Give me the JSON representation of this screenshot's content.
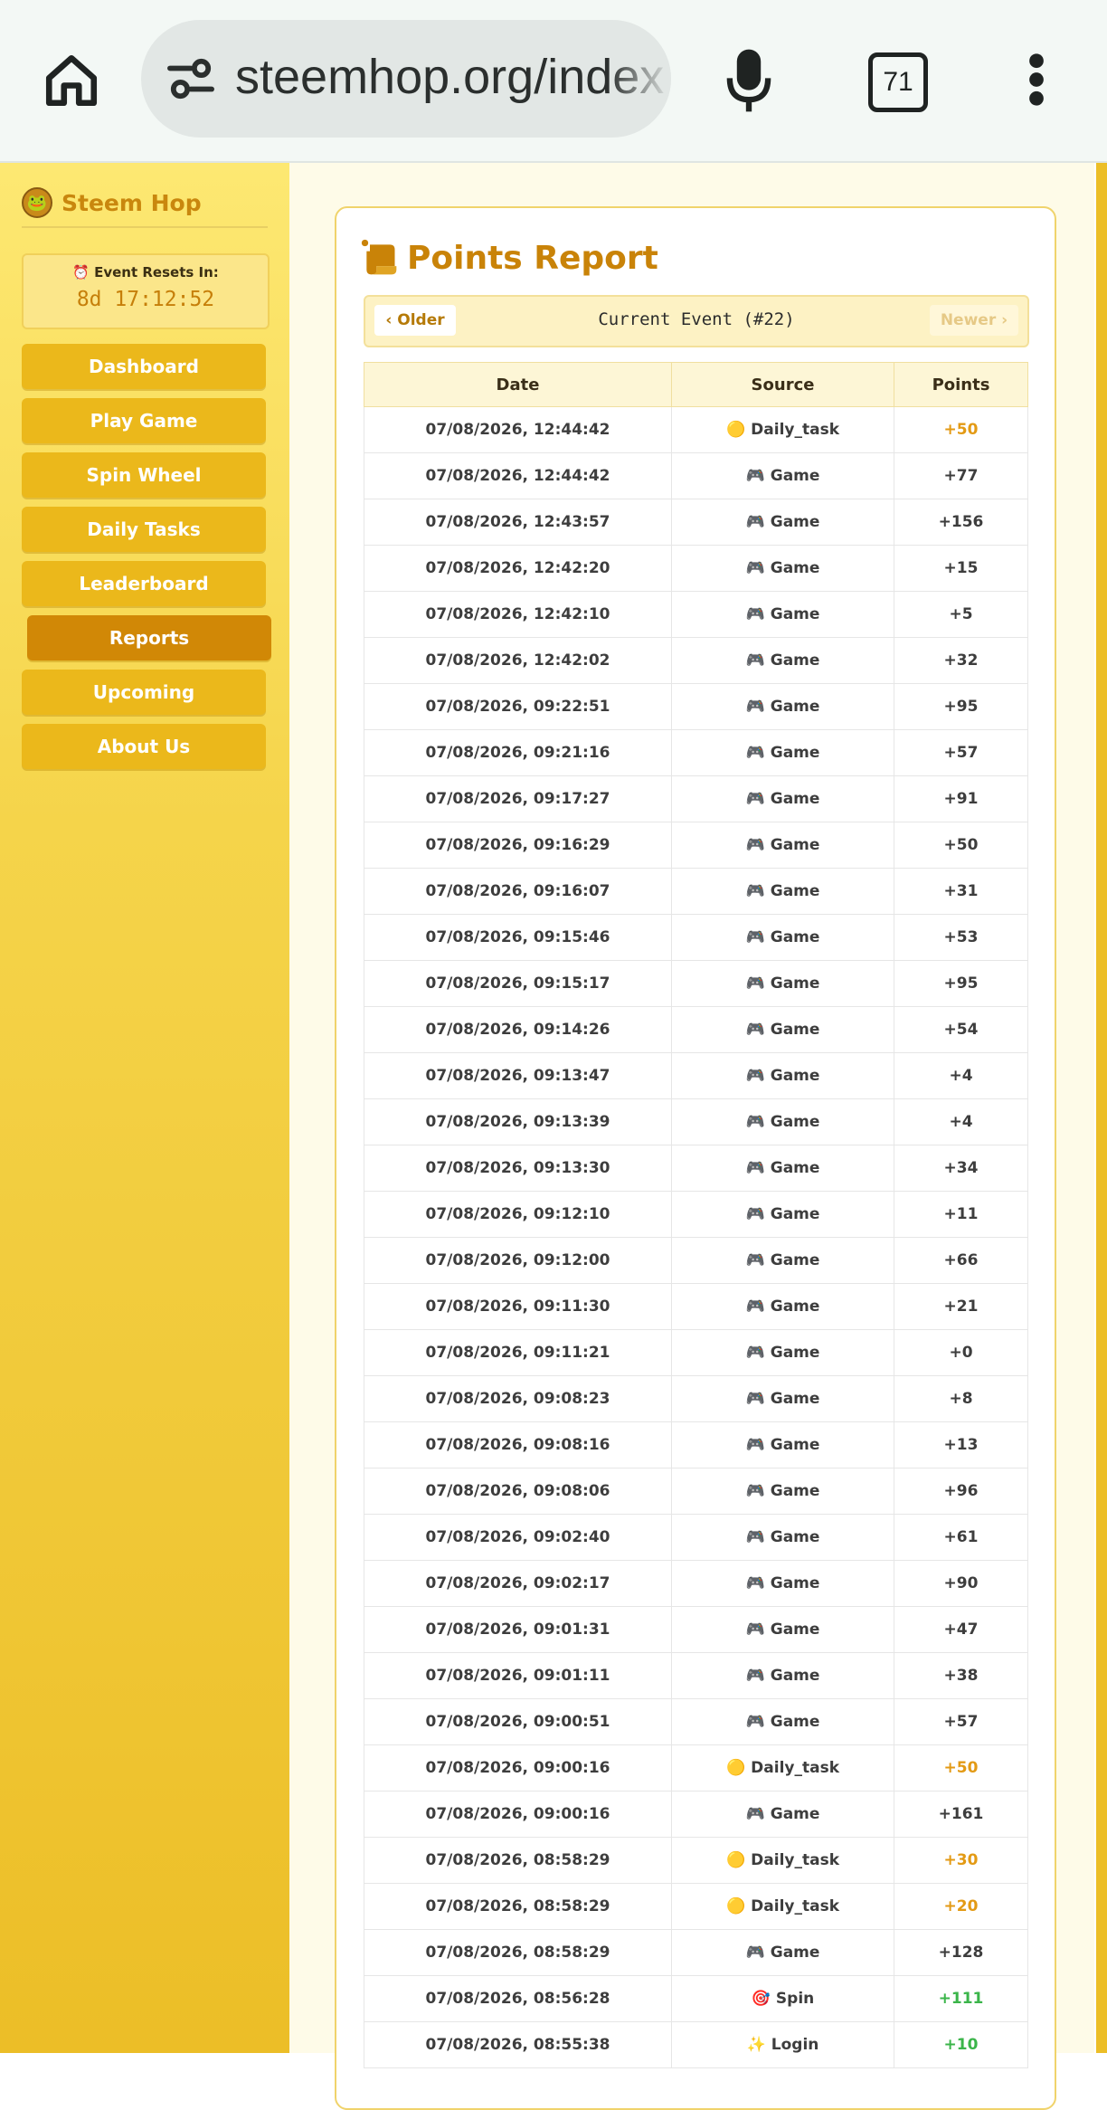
{
  "browser": {
    "url": "steemhop.org/index",
    "tab_count": "71"
  },
  "sidebar": {
    "brand": "Steem Hop",
    "timer_label": "⏰ Event Resets In:",
    "timer_value": "8d 17:12:52",
    "items": [
      {
        "label": "Dashboard"
      },
      {
        "label": "Play Game"
      },
      {
        "label": "Spin Wheel"
      },
      {
        "label": "Daily Tasks"
      },
      {
        "label": "Leaderboard"
      },
      {
        "label": "Reports"
      },
      {
        "label": "Upcoming"
      },
      {
        "label": "About Us"
      }
    ],
    "active_item": "Reports"
  },
  "main": {
    "title": "Points Report",
    "pager": {
      "older": "Older",
      "current": "Current Event (#22)",
      "newer": "Newer"
    },
    "columns": [
      "Date",
      "Source",
      "Points"
    ],
    "rows": [
      {
        "date": "07/08/2026, 12:44:42",
        "icon": "🟡",
        "source": "Daily_task",
        "points": "+50"
      },
      {
        "date": "07/08/2026, 12:44:42",
        "icon": "🎮",
        "source": "Game",
        "points": "+77"
      },
      {
        "date": "07/08/2026, 12:43:57",
        "icon": "🎮",
        "source": "Game",
        "points": "+156"
      },
      {
        "date": "07/08/2026, 12:42:20",
        "icon": "🎮",
        "source": "Game",
        "points": "+15"
      },
      {
        "date": "07/08/2026, 12:42:10",
        "icon": "🎮",
        "source": "Game",
        "points": "+5"
      },
      {
        "date": "07/08/2026, 12:42:02",
        "icon": "🎮",
        "source": "Game",
        "points": "+32"
      },
      {
        "date": "07/08/2026, 09:22:51",
        "icon": "🎮",
        "source": "Game",
        "points": "+95"
      },
      {
        "date": "07/08/2026, 09:21:16",
        "icon": "🎮",
        "source": "Game",
        "points": "+57"
      },
      {
        "date": "07/08/2026, 09:17:27",
        "icon": "🎮",
        "source": "Game",
        "points": "+91"
      },
      {
        "date": "07/08/2026, 09:16:29",
        "icon": "🎮",
        "source": "Game",
        "points": "+50"
      },
      {
        "date": "07/08/2026, 09:16:07",
        "icon": "🎮",
        "source": "Game",
        "points": "+31"
      },
      {
        "date": "07/08/2026, 09:15:46",
        "icon": "🎮",
        "source": "Game",
        "points": "+53"
      },
      {
        "date": "07/08/2026, 09:15:17",
        "icon": "🎮",
        "source": "Game",
        "points": "+95"
      },
      {
        "date": "07/08/2026, 09:14:26",
        "icon": "🎮",
        "source": "Game",
        "points": "+54"
      },
      {
        "date": "07/08/2026, 09:13:47",
        "icon": "🎮",
        "source": "Game",
        "points": "+4"
      },
      {
        "date": "07/08/2026, 09:13:39",
        "icon": "🎮",
        "source": "Game",
        "points": "+4"
      },
      {
        "date": "07/08/2026, 09:13:30",
        "icon": "🎮",
        "source": "Game",
        "points": "+34"
      },
      {
        "date": "07/08/2026, 09:12:10",
        "icon": "🎮",
        "source": "Game",
        "points": "+11"
      },
      {
        "date": "07/08/2026, 09:12:00",
        "icon": "🎮",
        "source": "Game",
        "points": "+66"
      },
      {
        "date": "07/08/2026, 09:11:30",
        "icon": "🎮",
        "source": "Game",
        "points": "+21"
      },
      {
        "date": "07/08/2026, 09:11:21",
        "icon": "🎮",
        "source": "Game",
        "points": "+0"
      },
      {
        "date": "07/08/2026, 09:08:23",
        "icon": "🎮",
        "source": "Game",
        "points": "+8"
      },
      {
        "date": "07/08/2026, 09:08:16",
        "icon": "🎮",
        "source": "Game",
        "points": "+13"
      },
      {
        "date": "07/08/2026, 09:08:06",
        "icon": "🎮",
        "source": "Game",
        "points": "+96"
      },
      {
        "date": "07/08/2026, 09:02:40",
        "icon": "🎮",
        "source": "Game",
        "points": "+61"
      },
      {
        "date": "07/08/2026, 09:02:17",
        "icon": "🎮",
        "source": "Game",
        "points": "+90"
      },
      {
        "date": "07/08/2026, 09:01:31",
        "icon": "🎮",
        "source": "Game",
        "points": "+47"
      },
      {
        "date": "07/08/2026, 09:01:11",
        "icon": "🎮",
        "source": "Game",
        "points": "+38"
      },
      {
        "date": "07/08/2026, 09:00:51",
        "icon": "🎮",
        "source": "Game",
        "points": "+57"
      },
      {
        "date": "07/08/2026, 09:00:16",
        "icon": "🟡",
        "source": "Daily_task",
        "points": "+50"
      },
      {
        "date": "07/08/2026, 09:00:16",
        "icon": "🎮",
        "source": "Game",
        "points": "+161"
      },
      {
        "date": "07/08/2026, 08:58:29",
        "icon": "🟡",
        "source": "Daily_task",
        "points": "+30"
      },
      {
        "date": "07/08/2026, 08:58:29",
        "icon": "🟡",
        "source": "Daily_task",
        "points": "+20"
      },
      {
        "date": "07/08/2026, 08:58:29",
        "icon": "🎮",
        "source": "Game",
        "points": "+128"
      },
      {
        "date": "07/08/2026, 08:56:28",
        "icon": "🎯",
        "source": "Spin",
        "points": "+111"
      },
      {
        "date": "07/08/2026, 08:55:38",
        "icon": "✨",
        "source": "Login",
        "points": "+10"
      }
    ]
  },
  "colors": {
    "game_points": "#4a86d8",
    "daily_task_points": "#e39a14",
    "spin_points": "#3bb54a",
    "accent": "#c98308"
  }
}
